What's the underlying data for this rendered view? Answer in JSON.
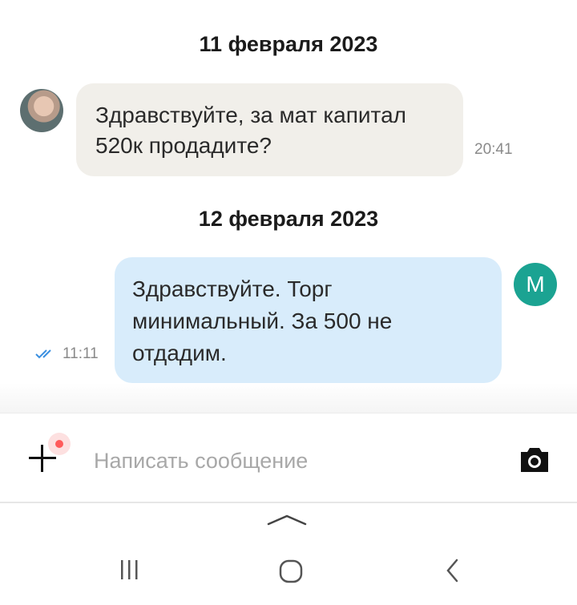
{
  "messages": {
    "date1": "11 февраля 2023",
    "in_text_line1": "Здравствуйте, за мат капитал",
    "in_text_line2": "520к продадите?",
    "in_time": "20:41",
    "date2": "12 февраля 2023",
    "out_text_line1": "Здравствуйте. Торг",
    "out_text_line2": "минимальный. За 500 не",
    "out_text_line3": "отдадим.",
    "out_time": "11:11",
    "out_avatar_letter": "M"
  },
  "composer": {
    "placeholder": "Написать сообщение",
    "attach_icon": "plus-icon",
    "camera_icon": "camera-icon"
  },
  "navbar": {
    "icons": [
      "chevron-up-icon",
      "recent-apps-icon",
      "home-icon",
      "back-icon"
    ]
  },
  "colors": {
    "incoming_bubble": "#f1efea",
    "outgoing_bubble": "#d8ecfb",
    "avatar_teal": "#1ba392",
    "read_check": "#3b8fe0",
    "notification_dot": "#ff5b5b"
  }
}
